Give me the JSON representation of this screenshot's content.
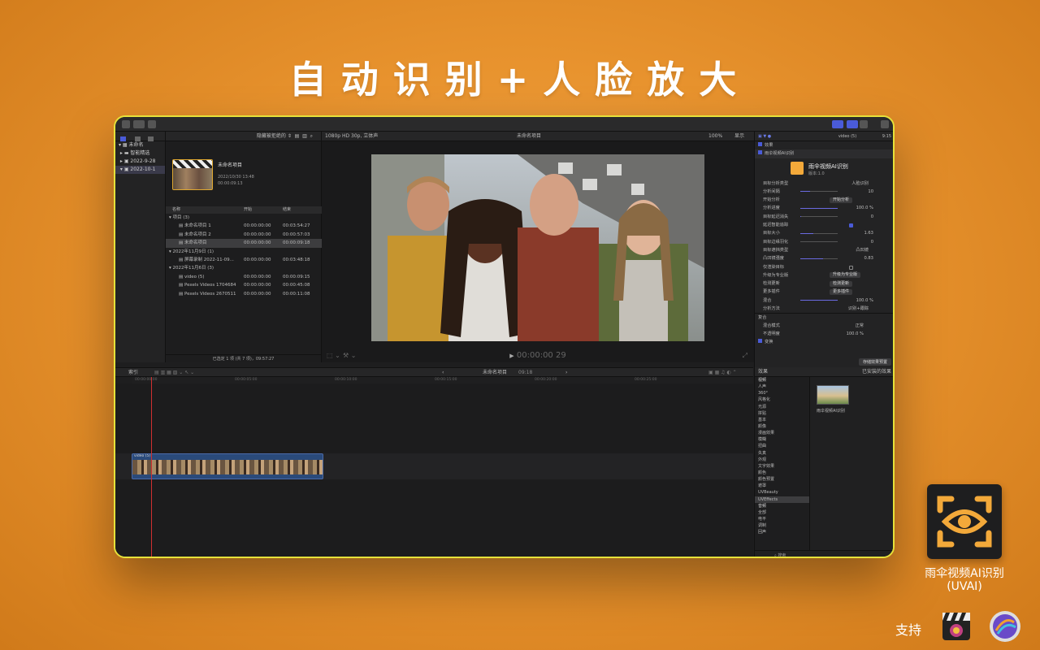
{
  "headline": "自动识别+人脸放大",
  "app": {
    "name_line1": "雨伞视频AI识别",
    "name_line2": "(UVAI)",
    "support_label": "支持"
  },
  "library": {
    "items": [
      "未命名",
      "智能精选",
      "2022-9-28",
      "2022-10-1"
    ]
  },
  "browser": {
    "filter": "隐藏被拒绝的",
    "project_title": "未命名项目",
    "project_date": "2022/10/30 13:48",
    "project_duration": "00:00:09:13",
    "columns": [
      "名称",
      "开始",
      "结束"
    ],
    "rows": [
      {
        "name": "项目 (3)",
        "start": "",
        "end": "",
        "kind": "group"
      },
      {
        "name": "未命名项目 1",
        "start": "00:00:00:00",
        "end": "00:03:54:27",
        "kind": "item"
      },
      {
        "name": "未命名项目 2",
        "start": "00:00:00:00",
        "end": "00:00:57:03",
        "kind": "item"
      },
      {
        "name": "未命名项目",
        "start": "00:00:00:00",
        "end": "00:00:09:18",
        "kind": "item",
        "selected": true
      },
      {
        "name": "2022年11月9日 (1)",
        "start": "",
        "end": "",
        "kind": "group"
      },
      {
        "name": "屏幕录制 2022-11-09...",
        "start": "00:00:00:00",
        "end": "00:03:48:18",
        "kind": "item"
      },
      {
        "name": "2022年11月6日 (3)",
        "start": "",
        "end": "",
        "kind": "group"
      },
      {
        "name": "video (5)",
        "start": "00:00:00:00",
        "end": "00:00:09:15",
        "kind": "item"
      },
      {
        "name": "Pexels Videos 1704684",
        "start": "00:00:00:00",
        "end": "00:00:45:08",
        "kind": "item"
      },
      {
        "name": "Pexels Videos 2670511",
        "start": "00:00:00:00",
        "end": "00:00:11:08",
        "kind": "item"
      }
    ],
    "footer": "已选定 1 项 (共 7 项)，09:57:27"
  },
  "viewer": {
    "format": "1080p HD 30p, 立体声",
    "project": "未命名项目",
    "zoom": "100%",
    "display": "显示",
    "timecode": "00:00:00 29"
  },
  "inspector": {
    "clip_label": "video (5)",
    "time": "9:15",
    "section_effects": "效果",
    "plugin_title": "雨伞视频AI识别",
    "plugin_version": "版本:1.0",
    "rows": [
      {
        "label": "目标分析类型",
        "value": "人脸识别",
        "type": "select"
      },
      {
        "label": "分析间隔",
        "value": "10",
        "type": "slider",
        "level": 0.25
      },
      {
        "label": "开始分析",
        "value": "开始分析",
        "type": "button"
      },
      {
        "label": "分析进度",
        "value": "100.0 %",
        "type": "slider",
        "level": 1.0
      },
      {
        "label": "目标延迟消失",
        "value": "0",
        "type": "slider",
        "level": 0.02
      },
      {
        "label": "延迟智能追踪",
        "value": "",
        "type": "check",
        "checked": true
      },
      {
        "label": "目标大小",
        "value": "1.63",
        "type": "slider",
        "level": 0.35
      },
      {
        "label": "目标边缘羽化",
        "value": "0",
        "type": "slider",
        "level": 0.0
      },
      {
        "label": "目标遮挡类型",
        "value": "凸凹镜",
        "type": "select"
      },
      {
        "label": "凸凹镜强度",
        "value": "0.83",
        "type": "slider",
        "level": 0.6
      },
      {
        "label": "仅渲染目标",
        "value": "",
        "type": "check",
        "checked": false
      },
      {
        "label": "升级为专业版",
        "value": "升级为专业版",
        "type": "button"
      },
      {
        "label": "检测更新",
        "value": "检测更新",
        "type": "button"
      },
      {
        "label": "更多插件",
        "value": "更多插件",
        "type": "button"
      },
      {
        "label": "混合",
        "value": "100.0 %",
        "type": "slider",
        "level": 1.0
      },
      {
        "label": "分析方法",
        "value": "识别+跟踪",
        "type": "select"
      }
    ],
    "composite": "复合",
    "blend_mode_label": "混合模式",
    "blend_mode_value": "正常",
    "opacity_label": "不透明度",
    "opacity_value": "100.0 %",
    "transform": "变换",
    "save_preset": "存储效果预置"
  },
  "timeline": {
    "index": "索引",
    "project": "未命名项目",
    "duration": "09:18",
    "ruler": [
      "00:00:00:00",
      "00:00:05:00",
      "00:00:10:00",
      "00:00:15:00",
      "00:00:20:00",
      "00:00:25:00"
    ],
    "clip_label": "video (5)"
  },
  "effects": {
    "title": "效果",
    "installed": "已安装的效果",
    "categories": [
      "视频",
      "人声",
      "360°",
      "风格化",
      "光源",
      "拼贴",
      "基本",
      "颜像",
      "漫画效果",
      "模糊",
      "扭曲",
      "失真",
      "外观",
      "文字效果",
      "颜色",
      "颜色预置",
      "遮罩",
      "UVBeauty",
      "UVEffects",
      "音频",
      "全部",
      "电平",
      "调制",
      "回声"
    ],
    "selected": "UVEffects",
    "effect_name": "雨伞视频AI识别",
    "search_placeholder": "搜索"
  },
  "colors": {
    "background": "#e8932e",
    "frame_border": "#e6e23a",
    "accent": "#4a5bd8",
    "icon_orange": "#f3a93a"
  }
}
